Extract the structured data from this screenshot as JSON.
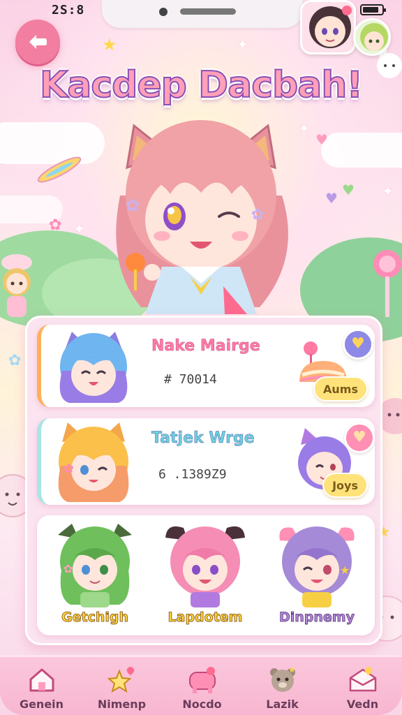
{
  "status_bar": {
    "time": "2S:8"
  },
  "header": {
    "title": "Kacdep Dacbah!"
  },
  "cards": [
    {
      "name": "Nake Mairge",
      "number": "# 70014",
      "tag": "Aums",
      "accent": "#ffb057"
    },
    {
      "name": "Tatjek Wrge",
      "number": "6 .1389Z9",
      "tag": "Joys",
      "accent": "#a9e4e7"
    }
  ],
  "trio": [
    {
      "label": "Getchigh",
      "hair": "#6fbf5c"
    },
    {
      "label": "Lapdotem",
      "hair": "#f58db4"
    },
    {
      "label": "Dinpnemy",
      "hair": "#a58ad8"
    }
  ],
  "nav": {
    "items": [
      {
        "label": "Genein",
        "icon": "home-icon"
      },
      {
        "label": "Nimenp",
        "icon": "star-heart-icon"
      },
      {
        "label": "Nocdo",
        "icon": "pet-icon"
      },
      {
        "label": "Lazik",
        "icon": "bear-icon"
      },
      {
        "label": "Vedn",
        "icon": "mail-icon"
      }
    ]
  },
  "colors": {
    "primary_pink": "#f27ea1",
    "accent_yellow": "#ffe27a",
    "panel": "#fbe3ef"
  }
}
